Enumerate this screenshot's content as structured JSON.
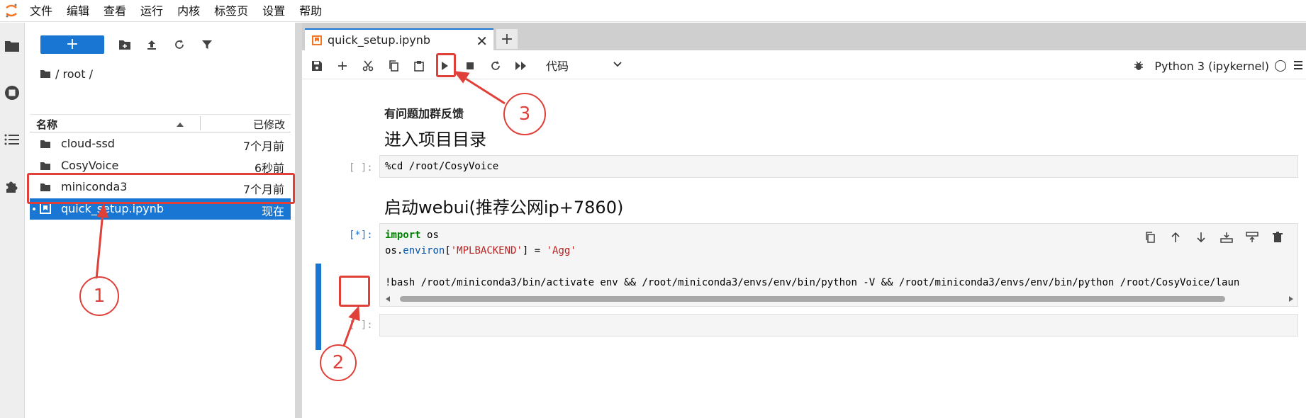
{
  "menubar": {
    "items": [
      "文件",
      "编辑",
      "查看",
      "运行",
      "内核",
      "标签页",
      "设置",
      "帮助"
    ]
  },
  "file_browser": {
    "new_button_label": "+",
    "breadcrumb": "/ root /",
    "columns": {
      "name": "名称",
      "modified": "已修改"
    },
    "items": [
      {
        "name": "cloud-ssd",
        "modified": "7个月前",
        "type": "folder"
      },
      {
        "name": "CosyVoice",
        "modified": "6秒前",
        "type": "folder"
      },
      {
        "name": "miniconda3",
        "modified": "7个月前",
        "type": "folder"
      },
      {
        "name": "quick_setup.ipynb",
        "modified": "现在",
        "type": "notebook",
        "selected": true
      }
    ]
  },
  "tabs": [
    {
      "label": "quick_setup.ipynb",
      "active": true
    }
  ],
  "notebook_toolbar": {
    "cell_type": "代码",
    "kernel_name": "Python 3 (ipykernel)"
  },
  "notebook": {
    "md_bold": "有问题加群反馈",
    "heading_1": "进入项目目录",
    "heading_2": "启动webui(推荐公网ip+7860)",
    "cells": [
      {
        "prompt": "[ ]:",
        "code": "%cd /root/CosyVoice"
      },
      {
        "prompt": "[*]:",
        "code_line_1": "os",
        "code_line_2": "'MPLBACKEND'",
        "code_line_3_value": "'Agg'",
        "code_line_4": "!bash /root/miniconda3/bin/activate env && /root/miniconda3/envs/env/bin/python -V && /root/miniconda3/envs/env/bin/python /root/CosyVoice/laun"
      },
      {
        "prompt": "[ ]:",
        "code": ""
      }
    ]
  },
  "annotations": [
    "1",
    "2",
    "3"
  ],
  "colors": {
    "accent": "#1976d2",
    "annotation": "#e0403a"
  }
}
